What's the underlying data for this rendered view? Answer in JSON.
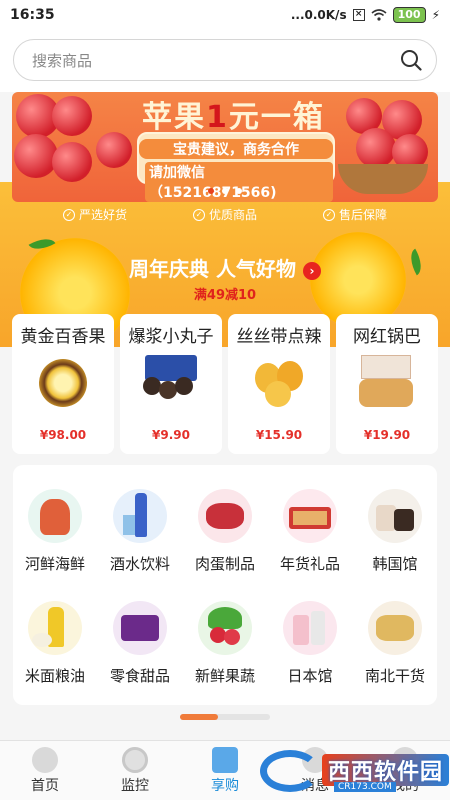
{
  "status": {
    "time": "16:35",
    "network_speed": "...0.0K/s",
    "battery": "100",
    "sim_icon": "sim-x-icon",
    "wifi_icon": "wifi-icon",
    "charge_icon": "lightning-icon"
  },
  "search": {
    "placeholder": "搜索商品",
    "icon": "search-icon"
  },
  "banner": {
    "title_prefix": "苹果",
    "title_num": "1",
    "title_suffix": "元一箱",
    "line1": "宝贵建议，商务合作",
    "line2": "请加微信（15216871566)",
    "dot_count": 3,
    "active_dot": 0
  },
  "features": [
    {
      "label": "严选好货"
    },
    {
      "label": "优质商品"
    },
    {
      "label": "售后保障"
    }
  ],
  "promo": {
    "title": "周年庆典 人气好物",
    "subtitle": "满49减10",
    "arrow_icon": "chevron-right-icon"
  },
  "products": [
    {
      "name": "黄金百香果",
      "price": "¥98.00"
    },
    {
      "name": "爆浆小丸子",
      "price": "¥9.90"
    },
    {
      "name": "丝丝带点辣",
      "price": "¥15.90"
    },
    {
      "name": "网红锅巴",
      "price": "¥19.90"
    }
  ],
  "categories": [
    {
      "label": "河鲜海鲜",
      "icon": "seafood-icon",
      "color": "#e8f6f1"
    },
    {
      "label": "酒水饮料",
      "icon": "drinks-icon",
      "color": "#e6f0fb"
    },
    {
      "label": "肉蛋制品",
      "icon": "meat-icon",
      "color": "#fbe6ea"
    },
    {
      "label": "年货礼品",
      "icon": "gift-icon",
      "color": "#fde9ee"
    },
    {
      "label": "韩国馆",
      "icon": "korea-icon",
      "color": "#f4f0ea"
    },
    {
      "label": "米面粮油",
      "icon": "grain-oil-icon",
      "color": "#fbf5dc"
    },
    {
      "label": "零食甜品",
      "icon": "snacks-icon",
      "color": "#f2e7f5"
    },
    {
      "label": "新鲜果蔬",
      "icon": "vegetables-icon",
      "color": "#e9f6e6"
    },
    {
      "label": "日本馆",
      "icon": "japan-icon",
      "color": "#fbe7ee"
    },
    {
      "label": "南北干货",
      "icon": "dried-goods-icon",
      "color": "#f7efe2"
    }
  ],
  "scroll_position": 0.42,
  "tabs": [
    {
      "label": "首页",
      "icon": "home-icon",
      "active": false
    },
    {
      "label": "监控",
      "icon": "camera-icon",
      "active": false
    },
    {
      "label": "享购",
      "icon": "gift-box-icon",
      "active": true
    },
    {
      "label": "消息",
      "icon": "message-icon",
      "active": false
    },
    {
      "label": "我的",
      "icon": "user-icon",
      "active": false
    }
  ],
  "watermark": {
    "text": "西西软件园",
    "sub": "CR173.COM"
  },
  "colors": {
    "accent": "#f07b3a",
    "price": "#e4302a",
    "active_tab": "#1a8bd8"
  }
}
